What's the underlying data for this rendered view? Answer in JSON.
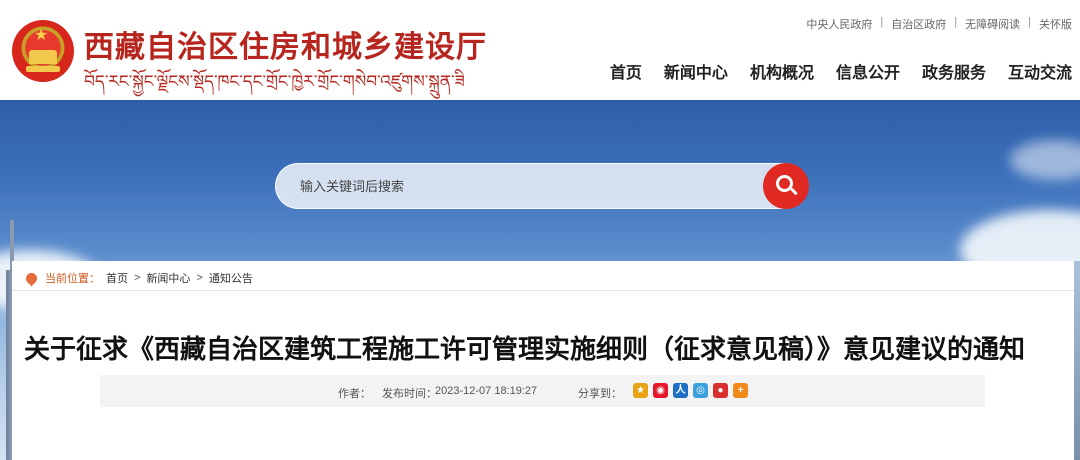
{
  "header": {
    "site_title": "西藏自治区住房和城乡建设厅",
    "site_subtitle_tibetan": "བོད་རང་སྐྱོང་ལྗོངས་སྡོད་ཁང་དང་གྲོང་ཁྱེར་གྲོང་གསེབ་འཛུགས་སྐྲུན་ཟིང་།",
    "top_links": [
      "中央人民政府",
      "自治区政府",
      "无障碍阅读",
      "关怀版"
    ],
    "nav": [
      "首页",
      "新闻中心",
      "机构概况",
      "信息公开",
      "政务服务",
      "互动交流"
    ]
  },
  "search": {
    "placeholder": "输入关键词后搜索"
  },
  "breadcrumb": {
    "label": "当前位置：",
    "items": [
      "首页",
      "新闻中心",
      "通知公告"
    ],
    "separator": ">"
  },
  "article": {
    "title": "关于征求《西藏自治区建筑工程施工许可管理实施细则（征求意见稿）》意见建议的通知",
    "author_label": "作者：",
    "publish_label": "发布时间：",
    "publish_time": "2023-12-07 18:19:27",
    "share_label": "分享到："
  },
  "share_icons": [
    {
      "name": "qzone-icon",
      "color": "#e8a317"
    },
    {
      "name": "weibo-icon",
      "color": "#e6162d"
    },
    {
      "name": "renren-icon",
      "color": "#1f6fc5"
    },
    {
      "name": "tencent-weibo-icon",
      "color": "#3aa0e0"
    },
    {
      "name": "people-weibo-icon",
      "color": "#d9302f"
    },
    {
      "name": "more-share-icon",
      "color": "#f08a1c"
    }
  ]
}
